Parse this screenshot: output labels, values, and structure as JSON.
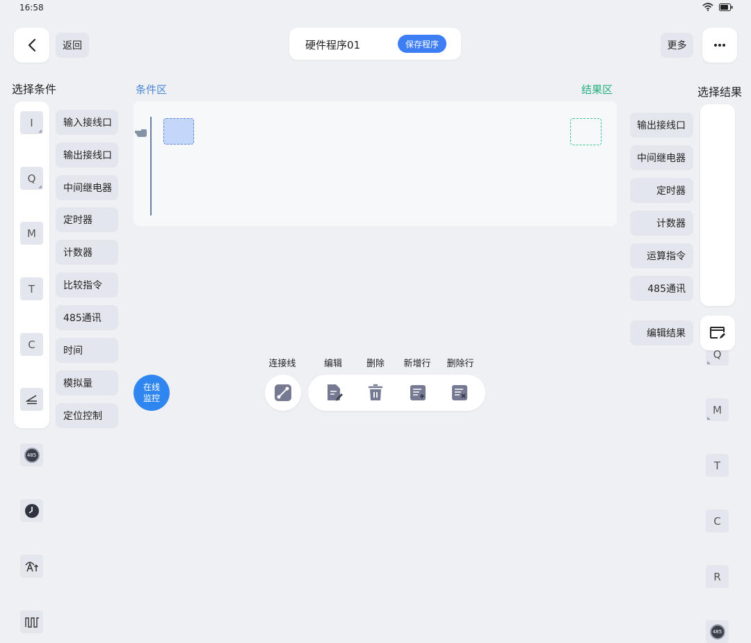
{
  "status": {
    "time": "16:58"
  },
  "header": {
    "back_label": "返回",
    "program_name": "硬件程序01",
    "save_label": "保存程序",
    "more_label": "更多"
  },
  "left_panel": {
    "title": "选择条件",
    "items": [
      {
        "symbol": "I",
        "label": "输入接线口"
      },
      {
        "symbol": "Q",
        "label": "输出接线口"
      },
      {
        "symbol": "M",
        "label": "中间继电器"
      },
      {
        "symbol": "T",
        "label": "定时器"
      },
      {
        "symbol": "C",
        "label": "计数器"
      },
      {
        "symbol": "compare-icon",
        "label": "比较指令"
      },
      {
        "symbol": "485",
        "label": "485通讯"
      },
      {
        "symbol": "clock-icon",
        "label": "时间"
      },
      {
        "symbol": "analog-icon",
        "label": "模拟量"
      },
      {
        "symbol": "pulse-icon",
        "label": "定位控制"
      }
    ]
  },
  "canvas": {
    "condition_title": "条件区",
    "result_title": "结果区"
  },
  "right_panel": {
    "title": "选择结果",
    "items": [
      {
        "symbol": "Q",
        "label": "输出接线口"
      },
      {
        "symbol": "M",
        "label": "中间继电器"
      },
      {
        "symbol": "T",
        "label": "定时器"
      },
      {
        "symbol": "C",
        "label": "计数器"
      },
      {
        "symbol": "R",
        "label": "运算指令"
      },
      {
        "symbol": "485",
        "label": "485通讯"
      }
    ],
    "edit_result_label": "编辑结果"
  },
  "toolbar": {
    "connect_label": "连接线",
    "edit_label": "编辑",
    "delete_label": "删除",
    "add_row_label": "新增行",
    "delete_row_label": "删除行"
  },
  "monitor": {
    "line1": "在线",
    "line2": "监控"
  },
  "colors": {
    "accent_blue": "#3d7ef5",
    "condition_title": "#4a86d6",
    "result_title": "#27b07c",
    "dashed_green": "#3cc08a"
  }
}
